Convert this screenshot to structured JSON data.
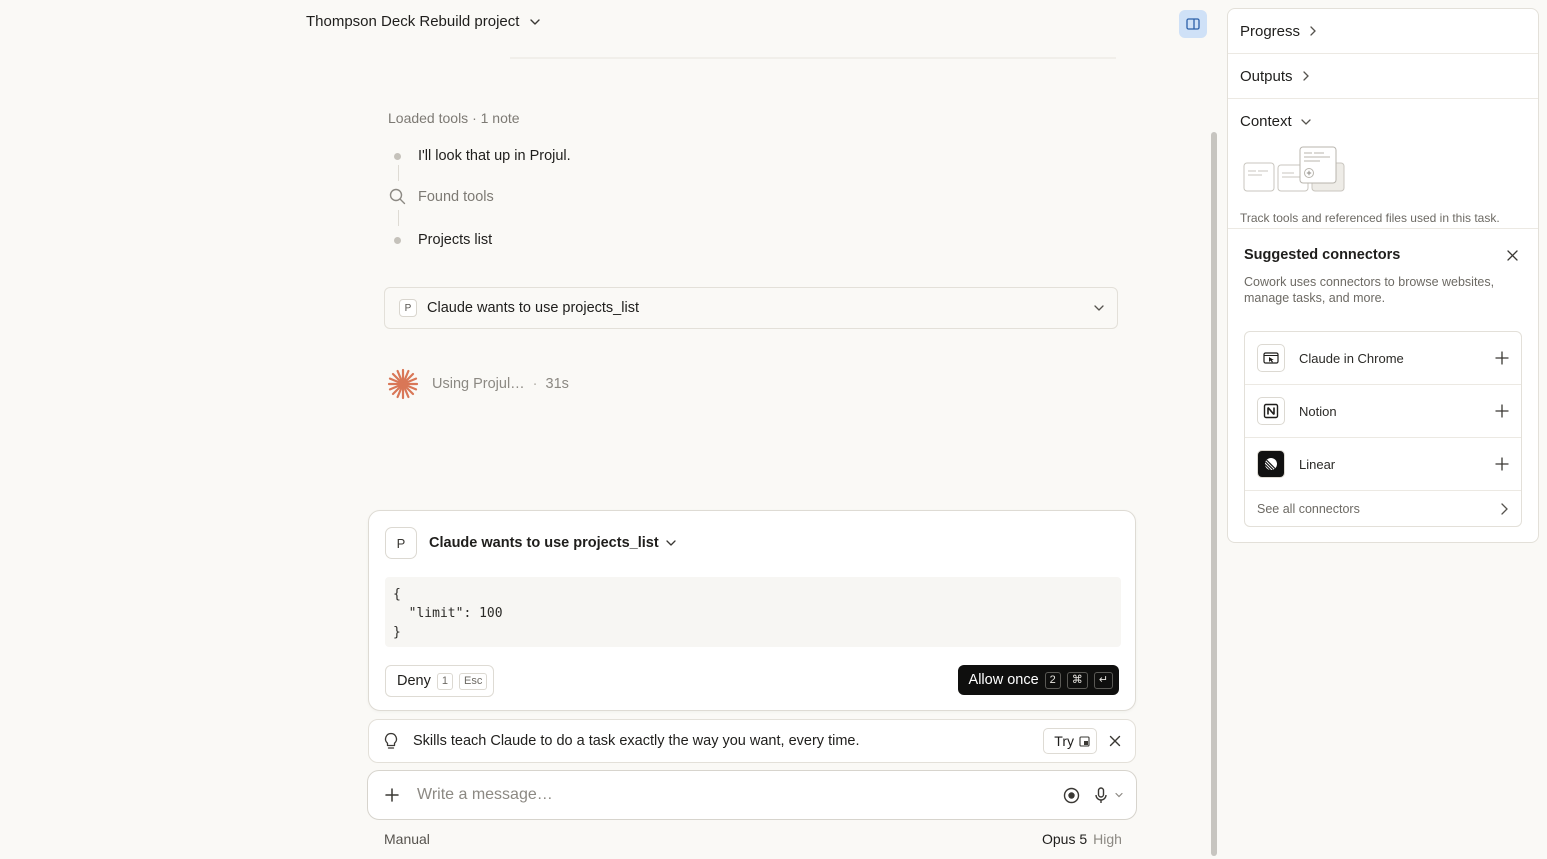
{
  "header": {
    "project_title": "Thompson Deck Rebuild project"
  },
  "activity": {
    "loaded_label": "Loaded tools · 1 note",
    "steps": [
      {
        "label": "I'll look that up in Projul."
      },
      {
        "label": "Found tools"
      },
      {
        "label": "Projects list"
      }
    ],
    "collapsed_request": {
      "badge": "P",
      "label": "Claude wants to use projects_list"
    },
    "status": {
      "text": "Using Projul…",
      "separator": "·",
      "elapsed": "31s",
      "accent_color": "#d97757"
    }
  },
  "approval": {
    "badge": "P",
    "title": "Claude wants to use projects_list",
    "code_lines": [
      "{",
      "  \"limit\": 100",
      "}"
    ],
    "deny": {
      "label": "Deny",
      "shortcut": "1",
      "alt_shortcut": "Esc"
    },
    "allow": {
      "label": "Allow once",
      "shortcut": "2",
      "modifier": "⌘",
      "enter": "↵"
    }
  },
  "tip": {
    "icon": "lightbulb-icon",
    "text": "Skills teach Claude to do a task exactly the way you want, every time.",
    "try_label": "Try"
  },
  "composer": {
    "placeholder": "Write a message…",
    "mode": "Manual",
    "model": "Opus 5",
    "effort": "High"
  },
  "panel": {
    "sections": [
      {
        "label": "Progress",
        "state": "collapsed"
      },
      {
        "label": "Outputs",
        "state": "collapsed"
      },
      {
        "label": "Context",
        "state": "expanded"
      }
    ],
    "context_description": "Track tools and referenced files used in this task.",
    "suggested": {
      "title": "Suggested connectors",
      "description": "Cowork uses connectors to browse websites, manage tasks, and more.",
      "connectors": [
        {
          "name": "Claude in Chrome",
          "icon": "chrome-cursor-icon"
        },
        {
          "name": "Notion",
          "icon": "notion-icon"
        },
        {
          "name": "Linear",
          "icon": "linear-icon"
        }
      ],
      "see_all": "See all connectors"
    }
  },
  "colors": {
    "background": "#faf9f6",
    "toggle_active": "#cfe1f7",
    "allow_button": "#0f0f0e",
    "spinner": "#d97757"
  }
}
